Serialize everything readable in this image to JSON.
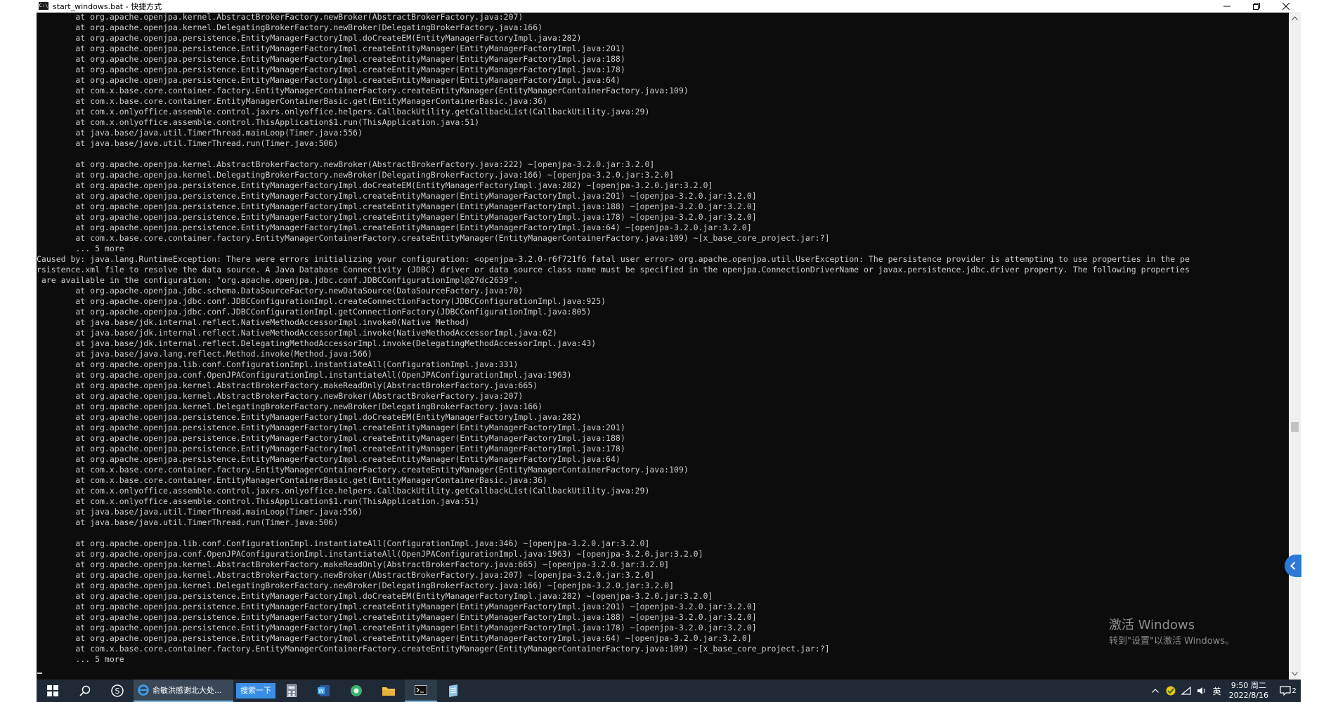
{
  "window": {
    "title": "start_windows.bat - 快捷方式",
    "icon_text": "C:\\",
    "controls": [
      "minimize-icon",
      "restore-icon",
      "close-icon"
    ]
  },
  "console": {
    "lines": [
      "        at org.apache.openjpa.kernel.AbstractBrokerFactory.newBroker(AbstractBrokerFactory.java:207)",
      "        at org.apache.openjpa.kernel.DelegatingBrokerFactory.newBroker(DelegatingBrokerFactory.java:166)",
      "        at org.apache.openjpa.persistence.EntityManagerFactoryImpl.doCreateEM(EntityManagerFactoryImpl.java:282)",
      "        at org.apache.openjpa.persistence.EntityManagerFactoryImpl.createEntityManager(EntityManagerFactoryImpl.java:201)",
      "        at org.apache.openjpa.persistence.EntityManagerFactoryImpl.createEntityManager(EntityManagerFactoryImpl.java:188)",
      "        at org.apache.openjpa.persistence.EntityManagerFactoryImpl.createEntityManager(EntityManagerFactoryImpl.java:178)",
      "        at org.apache.openjpa.persistence.EntityManagerFactoryImpl.createEntityManager(EntityManagerFactoryImpl.java:64)",
      "        at com.x.base.core.container.factory.EntityManagerContainerFactory.createEntityManager(EntityManagerContainerFactory.java:109)",
      "        at com.x.base.core.container.EntityManagerContainerBasic.get(EntityManagerContainerBasic.java:36)",
      "        at com.x.onlyoffice.assemble.control.jaxrs.onlyoffice.helpers.CallbackUtility.getCallbackList(CallbackUtility.java:29)",
      "        at com.x.onlyoffice.assemble.control.ThisApplication$1.run(ThisApplication.java:51)",
      "        at java.base/java.util.TimerThread.mainLoop(Timer.java:556)",
      "        at java.base/java.util.TimerThread.run(Timer.java:506)",
      "",
      "        at org.apache.openjpa.kernel.AbstractBrokerFactory.newBroker(AbstractBrokerFactory.java:222) ~[openjpa-3.2.0.jar:3.2.0]",
      "        at org.apache.openjpa.kernel.DelegatingBrokerFactory.newBroker(DelegatingBrokerFactory.java:166) ~[openjpa-3.2.0.jar:3.2.0]",
      "        at org.apache.openjpa.persistence.EntityManagerFactoryImpl.doCreateEM(EntityManagerFactoryImpl.java:282) ~[openjpa-3.2.0.jar:3.2.0]",
      "        at org.apache.openjpa.persistence.EntityManagerFactoryImpl.createEntityManager(EntityManagerFactoryImpl.java:201) ~[openjpa-3.2.0.jar:3.2.0]",
      "        at org.apache.openjpa.persistence.EntityManagerFactoryImpl.createEntityManager(EntityManagerFactoryImpl.java:188) ~[openjpa-3.2.0.jar:3.2.0]",
      "        at org.apache.openjpa.persistence.EntityManagerFactoryImpl.createEntityManager(EntityManagerFactoryImpl.java:178) ~[openjpa-3.2.0.jar:3.2.0]",
      "        at org.apache.openjpa.persistence.EntityManagerFactoryImpl.createEntityManager(EntityManagerFactoryImpl.java:64) ~[openjpa-3.2.0.jar:3.2.0]",
      "        at com.x.base.core.container.factory.EntityManagerContainerFactory.createEntityManager(EntityManagerContainerFactory.java:109) ~[x_base_core_project.jar:?]",
      "        ... 5 more",
      "Caused by: java.lang.RuntimeException: There were errors initializing your configuration: <openjpa-3.2.0-r6f721f6 fatal user error> org.apache.openjpa.util.UserException: The persistence provider is attempting to use properties in the pe",
      "rsistence.xml file to resolve the data source. A Java Database Connectivity (JDBC) driver or data source class name must be specified in the openjpa.ConnectionDriverName or javax.persistence.jdbc.driver property. The following properties",
      " are available in the configuration: \"org.apache.openjpa.jdbc.conf.JDBCConfigurationImpl@27dc2639\".",
      "        at org.apache.openjpa.jdbc.schema.DataSourceFactory.newDataSource(DataSourceFactory.java:70)",
      "        at org.apache.openjpa.jdbc.conf.JDBCConfigurationImpl.createConnectionFactory(JDBCConfigurationImpl.java:925)",
      "        at org.apache.openjpa.jdbc.conf.JDBCConfigurationImpl.getConnectionFactory(JDBCConfigurationImpl.java:805)",
      "        at java.base/jdk.internal.reflect.NativeMethodAccessorImpl.invoke0(Native Method)",
      "        at java.base/jdk.internal.reflect.NativeMethodAccessorImpl.invoke(NativeMethodAccessorImpl.java:62)",
      "        at java.base/jdk.internal.reflect.DelegatingMethodAccessorImpl.invoke(DelegatingMethodAccessorImpl.java:43)",
      "        at java.base/java.lang.reflect.Method.invoke(Method.java:566)",
      "        at org.apache.openjpa.lib.conf.ConfigurationImpl.instantiateAll(ConfigurationImpl.java:331)",
      "        at org.apache.openjpa.conf.OpenJPAConfigurationImpl.instantiateAll(OpenJPAConfigurationImpl.java:1963)",
      "        at org.apache.openjpa.kernel.AbstractBrokerFactory.makeReadOnly(AbstractBrokerFactory.java:665)",
      "        at org.apache.openjpa.kernel.AbstractBrokerFactory.newBroker(AbstractBrokerFactory.java:207)",
      "        at org.apache.openjpa.kernel.DelegatingBrokerFactory.newBroker(DelegatingBrokerFactory.java:166)",
      "        at org.apache.openjpa.persistence.EntityManagerFactoryImpl.doCreateEM(EntityManagerFactoryImpl.java:282)",
      "        at org.apache.openjpa.persistence.EntityManagerFactoryImpl.createEntityManager(EntityManagerFactoryImpl.java:201)",
      "        at org.apache.openjpa.persistence.EntityManagerFactoryImpl.createEntityManager(EntityManagerFactoryImpl.java:188)",
      "        at org.apache.openjpa.persistence.EntityManagerFactoryImpl.createEntityManager(EntityManagerFactoryImpl.java:178)",
      "        at org.apache.openjpa.persistence.EntityManagerFactoryImpl.createEntityManager(EntityManagerFactoryImpl.java:64)",
      "        at com.x.base.core.container.factory.EntityManagerContainerFactory.createEntityManager(EntityManagerContainerFactory.java:109)",
      "        at com.x.base.core.container.EntityManagerContainerBasic.get(EntityManagerContainerBasic.java:36)",
      "        at com.x.onlyoffice.assemble.control.jaxrs.onlyoffice.helpers.CallbackUtility.getCallbackList(CallbackUtility.java:29)",
      "        at com.x.onlyoffice.assemble.control.ThisApplication$1.run(ThisApplication.java:51)",
      "        at java.base/java.util.TimerThread.mainLoop(Timer.java:556)",
      "        at java.base/java.util.TimerThread.run(Timer.java:506)",
      "",
      "        at org.apache.openjpa.lib.conf.ConfigurationImpl.instantiateAll(ConfigurationImpl.java:346) ~[openjpa-3.2.0.jar:3.2.0]",
      "        at org.apache.openjpa.conf.OpenJPAConfigurationImpl.instantiateAll(OpenJPAConfigurationImpl.java:1963) ~[openjpa-3.2.0.jar:3.2.0]",
      "        at org.apache.openjpa.kernel.AbstractBrokerFactory.makeReadOnly(AbstractBrokerFactory.java:665) ~[openjpa-3.2.0.jar:3.2.0]",
      "        at org.apache.openjpa.kernel.AbstractBrokerFactory.newBroker(AbstractBrokerFactory.java:207) ~[openjpa-3.2.0.jar:3.2.0]",
      "        at org.apache.openjpa.kernel.DelegatingBrokerFactory.newBroker(DelegatingBrokerFactory.java:166) ~[openjpa-3.2.0.jar:3.2.0]",
      "        at org.apache.openjpa.persistence.EntityManagerFactoryImpl.doCreateEM(EntityManagerFactoryImpl.java:282) ~[openjpa-3.2.0.jar:3.2.0]",
      "        at org.apache.openjpa.persistence.EntityManagerFactoryImpl.createEntityManager(EntityManagerFactoryImpl.java:201) ~[openjpa-3.2.0.jar:3.2.0]",
      "        at org.apache.openjpa.persistence.EntityManagerFactoryImpl.createEntityManager(EntityManagerFactoryImpl.java:188) ~[openjpa-3.2.0.jar:3.2.0]",
      "        at org.apache.openjpa.persistence.EntityManagerFactoryImpl.createEntityManager(EntityManagerFactoryImpl.java:178) ~[openjpa-3.2.0.jar:3.2.0]",
      "        at org.apache.openjpa.persistence.EntityManagerFactoryImpl.createEntityManager(EntityManagerFactoryImpl.java:64) ~[openjpa-3.2.0.jar:3.2.0]",
      "        at com.x.base.core.container.factory.EntityManagerContainerFactory.createEntityManager(EntityManagerContainerFactory.java:109) ~[x_base_core_project.jar:?]",
      "        ... 5 more"
    ]
  },
  "watermark": {
    "title": "激活 Windows",
    "subtitle": "转到\"设置\"以激活 Windows。"
  },
  "taskbar": {
    "ie_label": "俞敏洪感谢北大处...",
    "search_button": "搜索一下",
    "tray_lang": "英",
    "time": "9:50 周二",
    "date": "2022/8/16",
    "notification_count": "2"
  },
  "colors": {
    "console_bg": "#0c0c0c",
    "console_text": "#cccccc",
    "taskbar_bg": "#1f2a36",
    "accent": "#2b79d6"
  }
}
